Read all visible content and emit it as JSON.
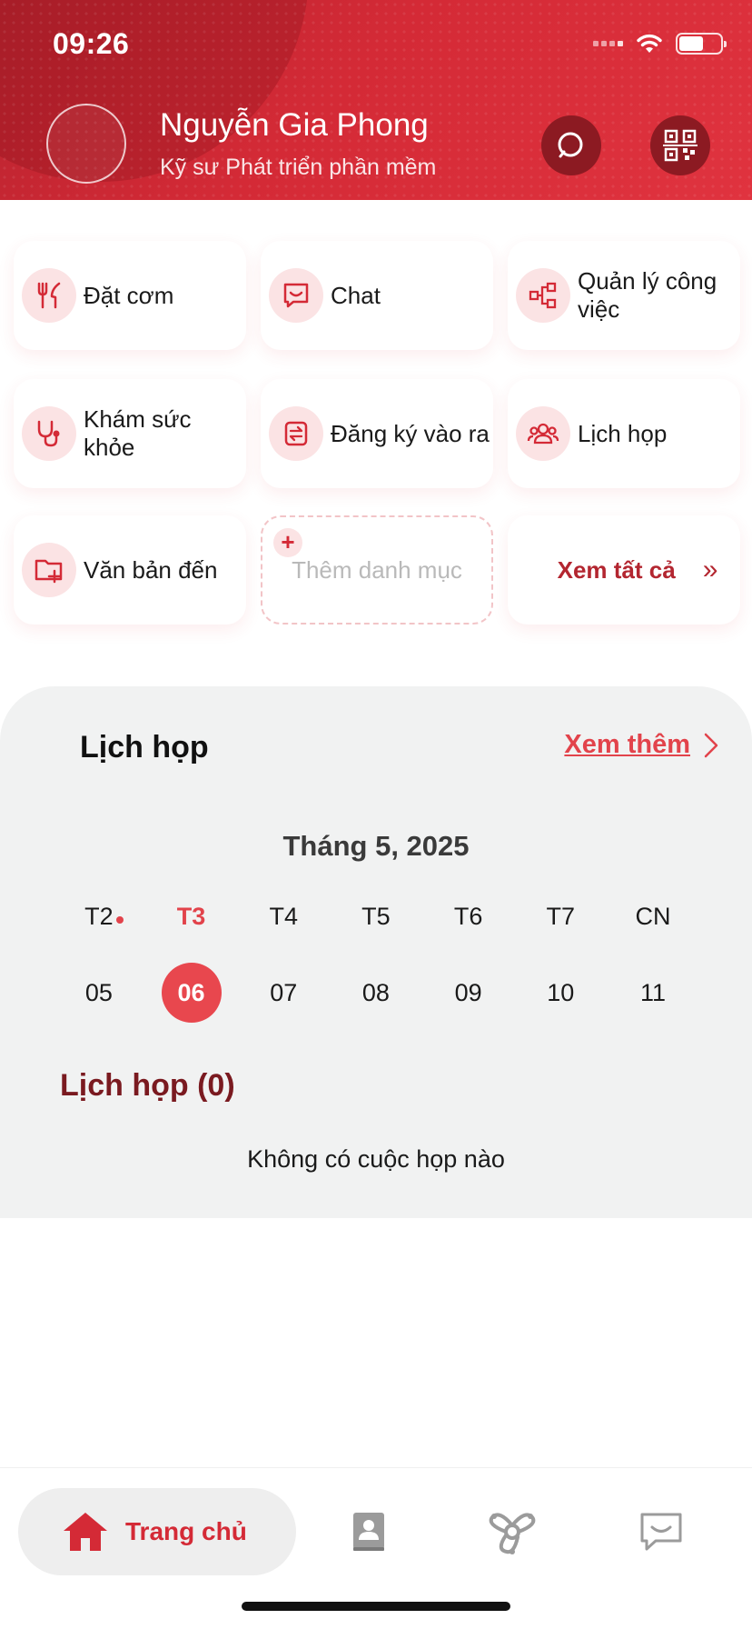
{
  "status_bar": {
    "time": "09:26"
  },
  "profile": {
    "name": "Nguyễn Gia Phong",
    "job_title": "Kỹ sư Phát triển phần mềm"
  },
  "header_actions": {
    "search_icon": "search-icon",
    "qr_icon": "qr-code-icon"
  },
  "quick_actions": [
    {
      "label": "Đặt cơm",
      "icon": "fork-knife-icon"
    },
    {
      "label": "Chat",
      "icon": "chat-icon"
    },
    {
      "label": "Quản lý công việc",
      "icon": "workflow-icon"
    },
    {
      "label": "Khám sức khỏe",
      "icon": "stethoscope-icon"
    },
    {
      "label": "Đăng ký vào ra",
      "icon": "swap-icon"
    },
    {
      "label": "Lịch họp",
      "icon": "group-icon"
    },
    {
      "label": "Văn bản đến",
      "icon": "folder-add-icon"
    }
  ],
  "add_category": {
    "label": "Thêm danh mục",
    "plus": "+"
  },
  "see_all": {
    "label": "Xem tất cả",
    "chevron": "»"
  },
  "meetings": {
    "title": "Lịch họp",
    "more_label": "Xem thêm",
    "month_label": "Tháng 5, 2025",
    "days": [
      {
        "name": "T2",
        "num": "05",
        "has_dot": true,
        "active": false
      },
      {
        "name": "T3",
        "num": "06",
        "has_dot": false,
        "active": true
      },
      {
        "name": "T4",
        "num": "07",
        "has_dot": false,
        "active": false
      },
      {
        "name": "T5",
        "num": "08",
        "has_dot": false,
        "active": false
      },
      {
        "name": "T6",
        "num": "09",
        "has_dot": false,
        "active": false
      },
      {
        "name": "T7",
        "num": "10",
        "has_dot": false,
        "active": false
      },
      {
        "name": "CN",
        "num": "11",
        "has_dot": false,
        "active": false
      }
    ],
    "count_title": "Lịch họp (0)",
    "empty_message": "Không có cuộc họp nào"
  },
  "bottom_nav": {
    "home_label": "Trang chủ",
    "tabs": [
      "home-icon",
      "contacts-icon",
      "network-icon",
      "chat-icon"
    ]
  },
  "colors": {
    "brand_red": "#d42a36",
    "accent_red": "#e2434b",
    "dark_red": "#7a1a20"
  }
}
